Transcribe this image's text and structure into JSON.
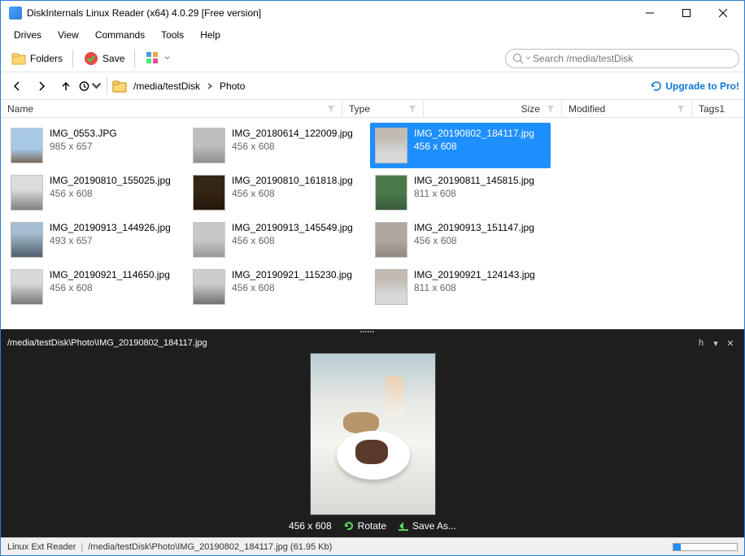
{
  "window": {
    "title": "DiskInternals Linux Reader (x64) 4.0.29 [Free version]"
  },
  "menu": {
    "drives": "Drives",
    "view": "View",
    "commands": "Commands",
    "tools": "Tools",
    "help": "Help"
  },
  "toolbar": {
    "folders": "Folders",
    "save": "Save"
  },
  "search": {
    "placeholder": "Search /media/testDisk"
  },
  "breadcrumb": {
    "path1": "/media/testDisk",
    "path2": "Photo"
  },
  "upgrade": "Upgrade to Pro!",
  "columns": {
    "name": "Name",
    "type": "Type",
    "size": "Size",
    "modified": "Modified",
    "tags": "Tags1"
  },
  "files": [
    {
      "name": "IMG_0553.JPG",
      "dim": "985 x 657",
      "selected": false,
      "thumb": "sky"
    },
    {
      "name": "IMG_20180614_122009.jpg",
      "dim": "456 x 608",
      "selected": false,
      "thumb": "stone"
    },
    {
      "name": "IMG_20190802_184117.jpg",
      "dim": "456 x 608",
      "selected": true,
      "thumb": "food"
    },
    {
      "name": "",
      "dim": "",
      "selected": false,
      "thumb": ""
    },
    {
      "name": "IMG_20190810_155025.jpg",
      "dim": "456 x 608",
      "selected": false,
      "thumb": "street"
    },
    {
      "name": "IMG_20190810_161818.jpg",
      "dim": "456 x 608",
      "selected": false,
      "thumb": "dark"
    },
    {
      "name": "IMG_20190811_145815.jpg",
      "dim": "811 x 608",
      "selected": false,
      "thumb": "green"
    },
    {
      "name": "",
      "dim": "",
      "selected": false,
      "thumb": ""
    },
    {
      "name": "IMG_20190913_144926.jpg",
      "dim": "493 x 657",
      "selected": false,
      "thumb": "church"
    },
    {
      "name": "IMG_20190913_145549.jpg",
      "dim": "456 x 608",
      "selected": false,
      "thumb": "stone"
    },
    {
      "name": "IMG_20190913_151147.jpg",
      "dim": "456 x 608",
      "selected": false,
      "thumb": "interior"
    },
    {
      "name": "",
      "dim": "",
      "selected": false,
      "thumb": ""
    },
    {
      "name": "IMG_20190921_114650.jpg",
      "dim": "456 x 608",
      "selected": false,
      "thumb": "city"
    },
    {
      "name": "IMG_20190921_115230.jpg",
      "dim": "456 x 608",
      "selected": false,
      "thumb": "city"
    },
    {
      "name": "IMG_20190921_124143.jpg",
      "dim": "811 x 608",
      "selected": false,
      "thumb": "food"
    },
    {
      "name": "",
      "dim": "",
      "selected": false,
      "thumb": ""
    }
  ],
  "preview": {
    "path": "/media/testDisk\\Photo\\IMG_20190802_184117.jpg",
    "h_label": "h",
    "dim": "456 x 608",
    "rotate": "Rotate",
    "saveas": "Save As..."
  },
  "status": {
    "reader": "Linux Ext Reader",
    "path": "/media/testDisk\\Photo\\IMG_20190802_184117.jpg (61.95 Kb)"
  }
}
